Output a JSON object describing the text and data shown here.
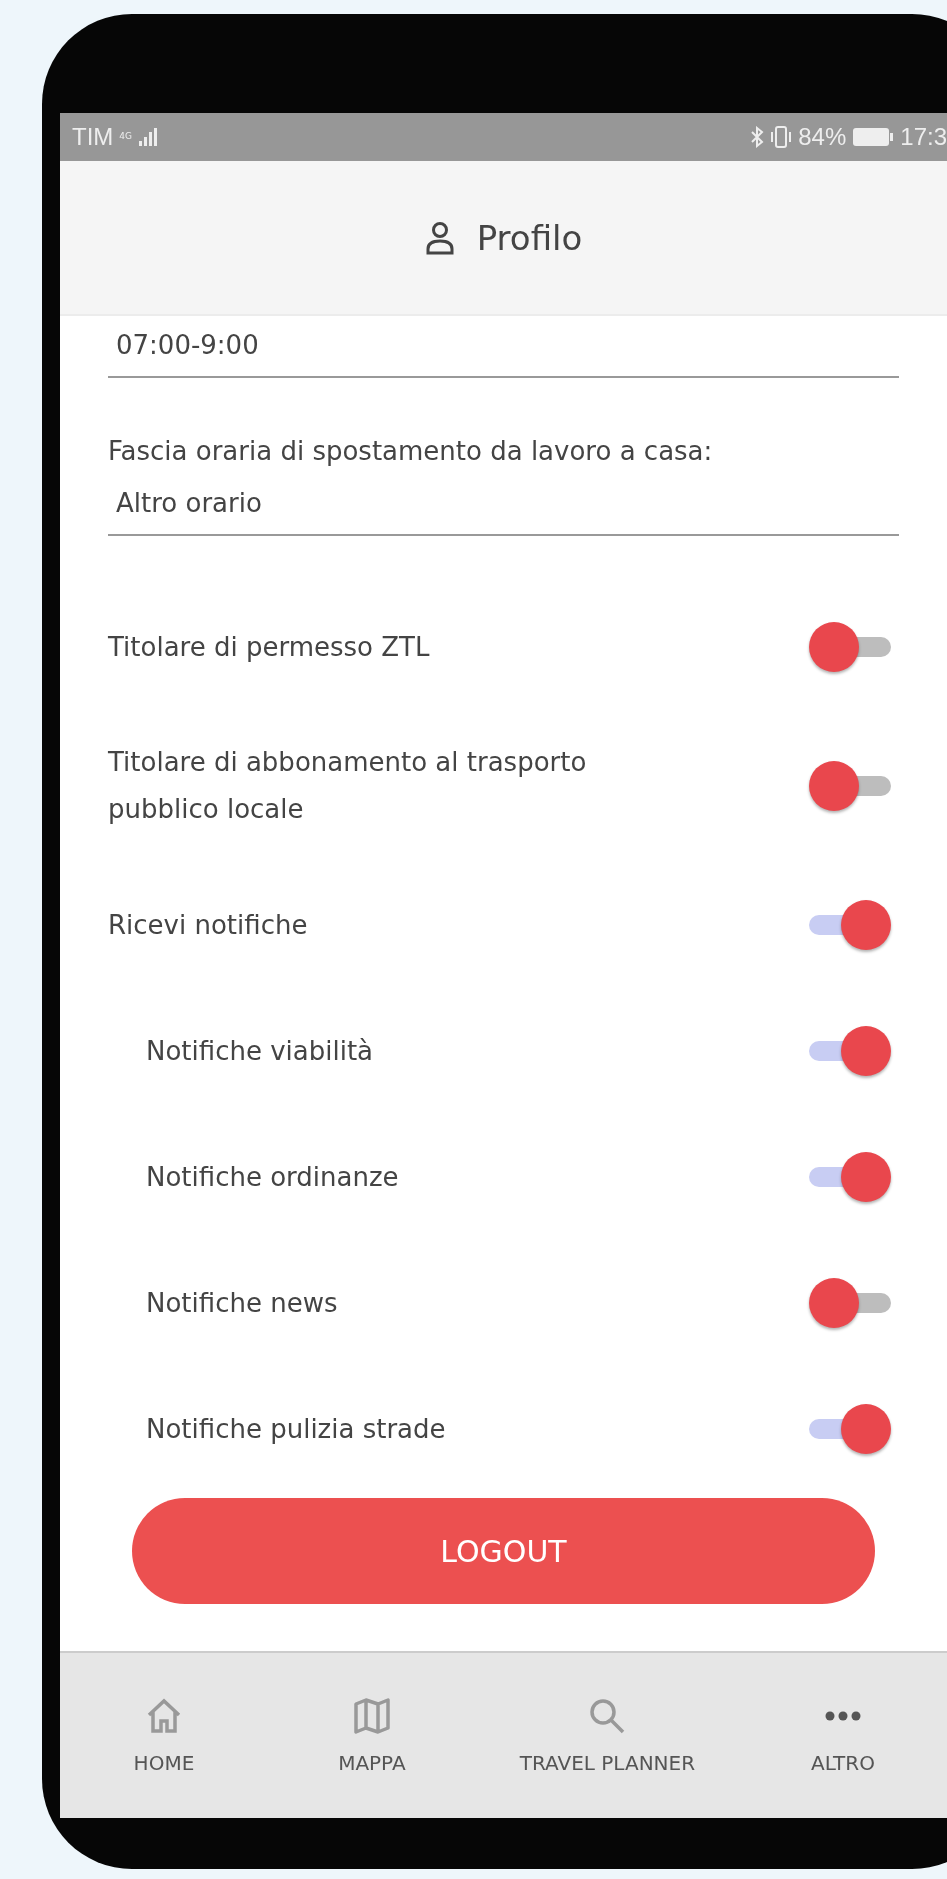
{
  "status_bar": {
    "carrier": "TIM",
    "network": "4G",
    "battery": "84%",
    "time": "17:3"
  },
  "header": {
    "title": "Profilo"
  },
  "fields": [
    {
      "value": "07:00-9:00"
    },
    {
      "label": "Fascia oraria di spostamento da lavoro a casa:",
      "value": "Altro orario"
    }
  ],
  "toggles": [
    {
      "label": "Titolare di permesso ZTL",
      "on": false
    },
    {
      "label": "Titolare di abbonamento al trasporto pubblico locale",
      "on": false
    },
    {
      "label": "Ricevi notifiche",
      "on": true,
      "children": [
        {
          "label": "Notifiche viabilità",
          "on": true
        },
        {
          "label": "Notifiche ordinanze",
          "on": true
        },
        {
          "label": "Notifiche news",
          "on": false
        },
        {
          "label": "Notifiche pulizia strade",
          "on": true
        }
      ]
    }
  ],
  "logout_button": "LOGOUT",
  "nav": [
    {
      "label": "HOME",
      "kind": "home"
    },
    {
      "label": "MAPPA",
      "kind": "map"
    },
    {
      "label": "TRAVEL PLANNER",
      "kind": "search"
    },
    {
      "label": "ALTRO",
      "kind": "more"
    }
  ]
}
